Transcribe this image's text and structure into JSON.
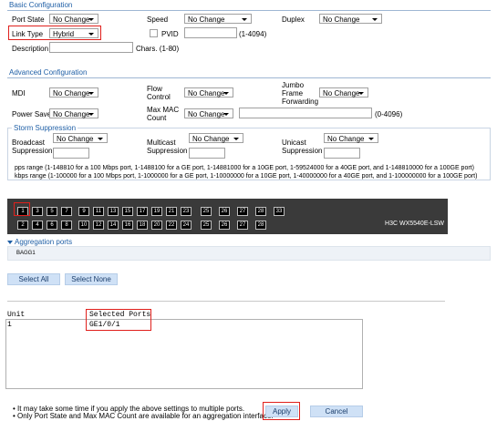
{
  "basic": {
    "title": "Basic Configuration",
    "port_state_label": "Port State",
    "port_state_value": "No Change",
    "speed_label": "Speed",
    "speed_value": "No Change",
    "duplex_label": "Duplex",
    "duplex_value": "No Change",
    "link_type_label": "Link Type",
    "link_type_value": "Hybrid",
    "pvid_label": "PVID",
    "pvid_range": "(1-4094)",
    "description_label": "Description",
    "description_hint": "Chars. (1-80)"
  },
  "advanced": {
    "title": "Advanced Configuration",
    "mdi_label": "MDI",
    "mdi_value": "No Change",
    "flow_control_label": "Flow Control",
    "flow_control_value": "No Change",
    "jumbo_label": "Jumbo Frame Forwarding",
    "jumbo_value": "No Change",
    "power_save_label": "Power Save",
    "power_save_value": "No Change",
    "max_mac_label": "Max MAC Count",
    "max_mac_value": "No Change",
    "max_mac_range": "(0-4096)"
  },
  "storm": {
    "title": "Storm Suppression",
    "broadcast_label": "Broadcast Suppression",
    "broadcast_value": "No Change",
    "multicast_label": "Multicast Suppression",
    "multicast_value": "No Change",
    "unicast_label": "Unicast Suppression",
    "unicast_value": "No Change",
    "pps_range": "pps range (1-148810 for a 100 Mbps port, 1-1488100 for a GE port, 1-14881000 for a 10GE port, 1-59524000 for a 40GE port, and 1-148810000 for a 100GE port)",
    "kbps_range": "kbps range (1-100000 for a 100 Mbps port, 1-1000000 for a GE port, 1-10000000 for a 10GE port, 1-40000000 for a 40GE port, and 1-100000000 for a 100GE port)"
  },
  "device": {
    "model": "H3C WX5540E-LSW",
    "top_ports": [
      "1",
      "3",
      "5",
      "7",
      "9",
      "11",
      "13",
      "15",
      "17",
      "19",
      "21",
      "23",
      "25",
      "26",
      "27",
      "28"
    ],
    "bottom_ports": [
      "2",
      "4",
      "6",
      "8",
      "10",
      "12",
      "14",
      "16",
      "18",
      "20",
      "22",
      "24",
      "25",
      "26",
      "27",
      "28"
    ],
    "extra_port": "33"
  },
  "aggregation": {
    "header": "Aggregation ports",
    "item": "BAGG1"
  },
  "buttons": {
    "select_all": "Select All",
    "select_none": "Select None",
    "apply": "Apply",
    "cancel": "Cancel"
  },
  "selected_table": {
    "col_unit": "Unit",
    "col_ports": "Selected Ports",
    "unit": "1",
    "ports": "GE1/0/1"
  },
  "notes": [
    "It may take some time if you apply the above settings to multiple ports.",
    "Only Port State and Max MAC Count are available for an aggregation interface."
  ],
  "colors": {
    "accent": "#1f5fa6",
    "highlight": "#e0201c",
    "button_bg": "#cfe1f6",
    "device_bg": "#3a3a3a"
  }
}
